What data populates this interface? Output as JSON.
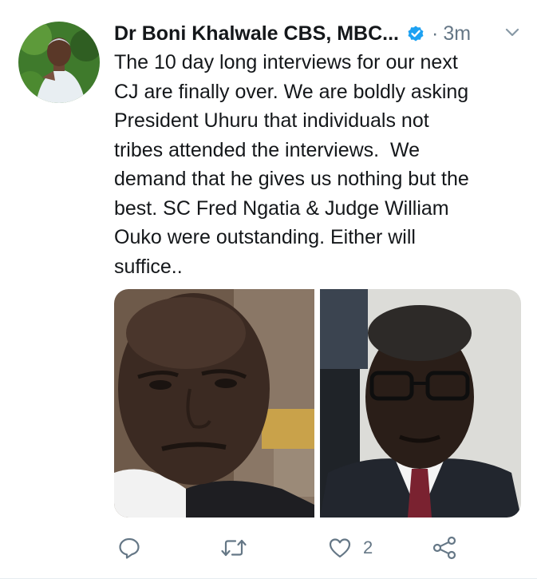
{
  "tweet": {
    "author_name": "Dr Boni Khalwale CBS, MBC...",
    "separator": "·",
    "timestamp": "3m",
    "text": "The 10 day long interviews for our next\nCJ are finally over. We are boldly asking\nPresident Uhuru that individuals not\ntribes attended the interviews.  We\ndemand that he gives us nothing but the\nbest. SC Fred Ngatia & Judge William\nOuko were outstanding. Either will\nsuffice..",
    "like_count": "2"
  },
  "colors": {
    "verified_blue": "#1da1f2",
    "icon_gray": "#657786",
    "text_dark": "#14171a"
  },
  "icons": {
    "verified": "verified-badge-icon",
    "caret": "chevron-down-icon",
    "reply": "reply-icon",
    "retweet": "retweet-icon",
    "like": "heart-icon",
    "share": "share-icon"
  }
}
